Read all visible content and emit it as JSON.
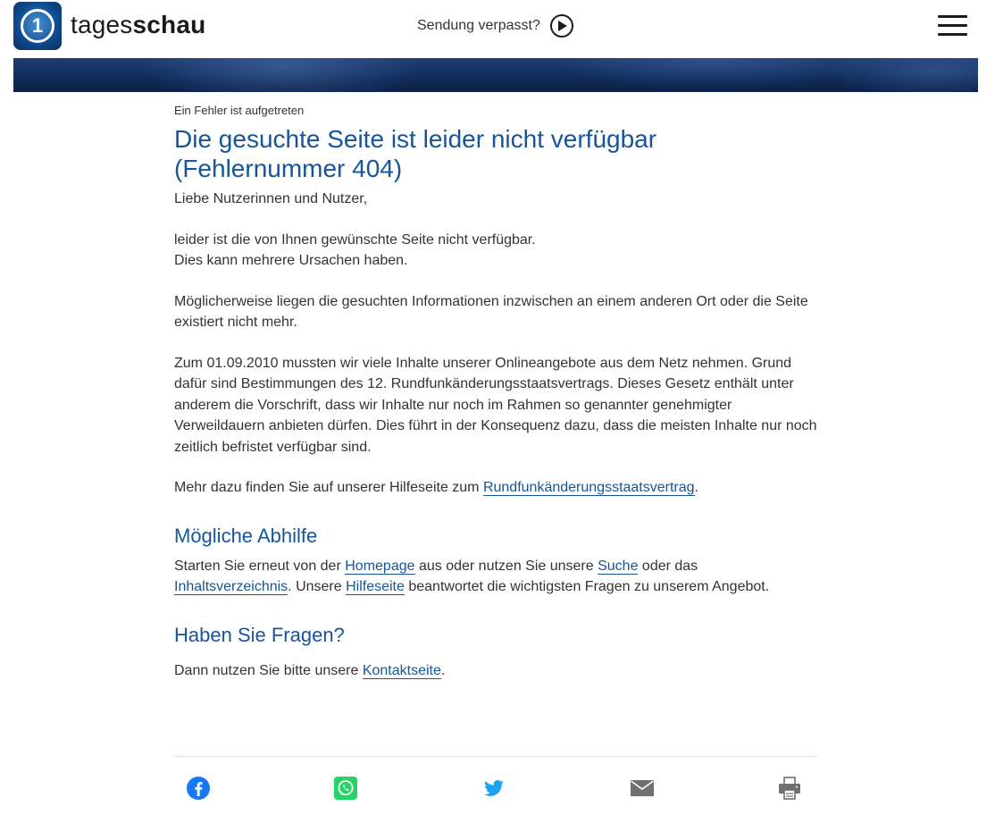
{
  "header": {
    "brand_light": "tages",
    "brand_bold": "schau",
    "missed_label": "Sendung verpasst?",
    "logo_glyph": "1",
    "menu_icon": "hamburger-menu-icon",
    "play_icon": "play-circle-icon"
  },
  "main": {
    "kicker": "Ein Fehler ist aufgetreten",
    "title": "Die gesuchte Seite ist leider nicht verfügbar (Fehlernummer 404)",
    "greeting": "Liebe Nutzerinnen und Nutzer,",
    "para1_line1": "leider ist die von Ihnen gewünschte Seite nicht verfügbar.",
    "para1_line2": "Dies kann mehrere Ursachen haben.",
    "para2": "Möglicherweise liegen die gesuchten Informationen inzwischen an einem anderen Ort oder die Seite existiert nicht mehr.",
    "para3": "Zum 01.09.2010 mussten wir viele Inhalte unserer Onlineangebote aus dem Netz nehmen. Grund dafür sind Bestimmungen des 12. Rundfunkänderungsstaatsvertrags. Dieses Gesetz enthält unter anderem die Vorschrift, dass wir Inhalte nur noch im Rahmen so genannter genehmigter Verweildauern anbieten dürfen. Dies führt in der Konsequenz dazu, dass die meisten Inhalte nur noch zeitlich befristet verfügbar sind.",
    "para4_prefix": "Mehr dazu finden Sie auf unserer Hilfeseite zum ",
    "para4_link": "Rundfunkänderungsstaatsvertrag",
    "para4_suffix": ".",
    "section1_title": "Mögliche Abhilfe",
    "section1_t1": "Starten Sie erneut von der ",
    "section1_link_homepage": "Homepage",
    "section1_t2": " aus oder nutzen Sie unsere ",
    "section1_link_search": "Suche",
    "section1_t3": " oder das ",
    "section1_link_index": "Inhaltsverzeichnis",
    "section1_t4": ". Unsere ",
    "section1_link_help": "Hilfeseite",
    "section1_t5": " beantwortet die wichtigsten Fragen zu unserem Angebot.",
    "section2_title": "Haben Sie Fragen?",
    "section2_t1": "Dann nutzen Sie bitte unsere ",
    "section2_link_contact": "Kontaktseite",
    "section2_t2": "."
  },
  "share": {
    "icons": [
      "facebook-icon",
      "whatsapp-icon",
      "twitter-icon",
      "email-icon",
      "print-icon"
    ]
  },
  "colors": {
    "link_blue": "#16559a",
    "facebook_blue": "#1877f2",
    "whatsapp_green": "#25d366",
    "twitter_blue": "#1da1f2",
    "icon_gray": "#707070",
    "banner_navy": "#102a59"
  }
}
